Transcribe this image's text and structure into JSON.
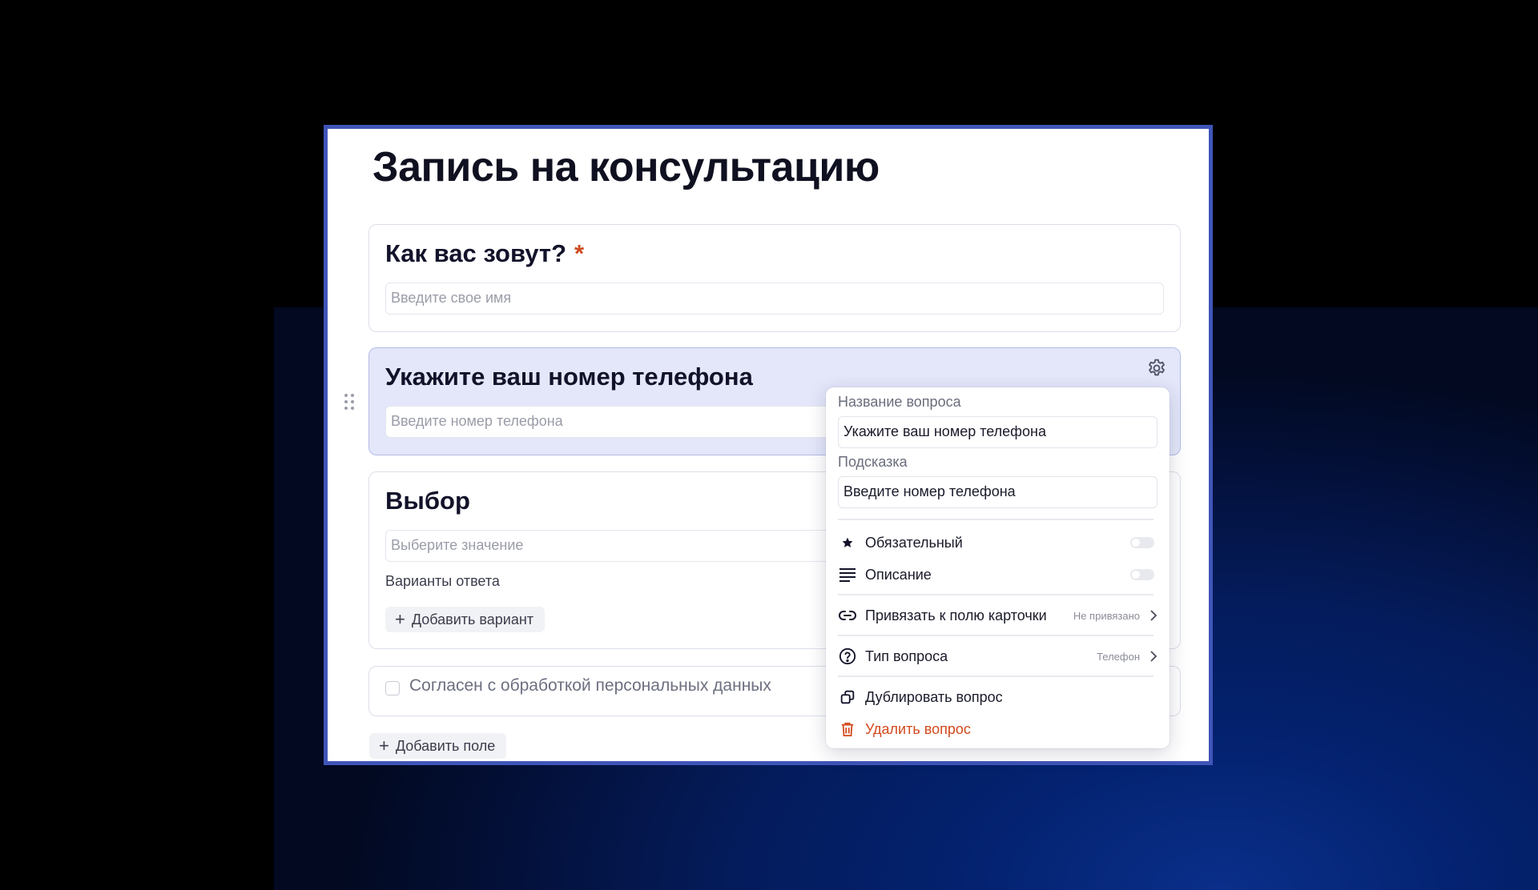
{
  "form": {
    "title": "Запись на консультацию",
    "questions": [
      {
        "title": "Как вас зовут?",
        "required_mark": "*",
        "placeholder": "Введите свое имя"
      },
      {
        "title": "Укажите ваш номер телефона",
        "placeholder": "Введите номер телефона"
      },
      {
        "title": "Выбор",
        "placeholder": "Выберите значение",
        "options_label": "Варианты ответа",
        "add_option_label": "Добавить вариант"
      }
    ],
    "consent_label": "Согласен с обработкой персональных данных",
    "add_field_label": "Добавить поле"
  },
  "popover": {
    "name_label": "Название вопроса",
    "name_value": "Укажите ваш номер телефона",
    "hint_label": "Подсказка",
    "hint_value": "Введите номер телефона",
    "required_label": "Обязательный",
    "description_label": "Описание",
    "link_label": "Привязать к полю карточки",
    "link_status": "Не привязано",
    "type_label": "Тип вопроса",
    "type_value": "Телефон",
    "duplicate_label": "Дублировать вопрос",
    "delete_label": "Удалить вопрос"
  },
  "colors": {
    "accent_frame": "#3f55b8",
    "active_card": "#e4e7fa",
    "required_star": "#d04a1f",
    "danger": "#d24a1c"
  },
  "icons": [
    "gear-icon",
    "drag-handle-icon",
    "plus-icon",
    "star-icon",
    "lines-icon",
    "link-icon",
    "question-circle-icon",
    "chevron-right-icon",
    "duplicate-icon",
    "trash-icon"
  ]
}
